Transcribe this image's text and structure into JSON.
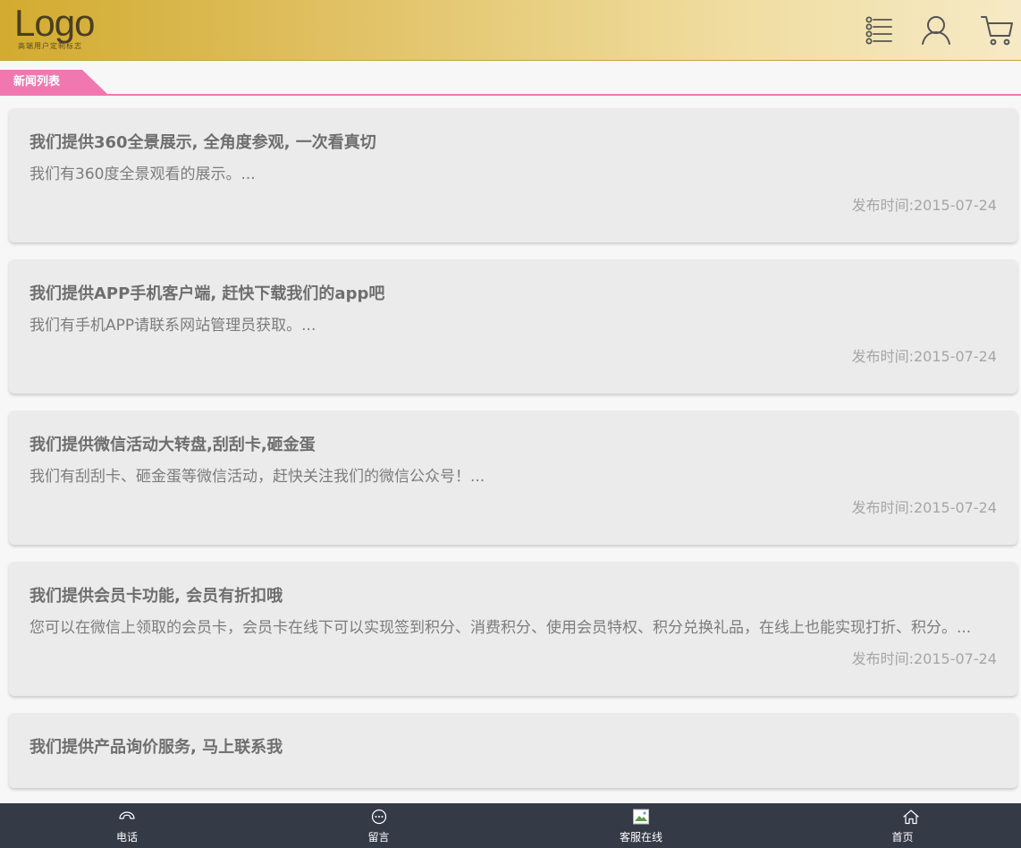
{
  "header": {
    "logo_text": "Logo",
    "logo_subtitle": "高端用户定制标志",
    "icons": [
      "menu-list-icon",
      "user-icon",
      "cart-icon"
    ],
    "gradient_colors": [
      "#d2ab2f",
      "#f6eac6"
    ]
  },
  "category": {
    "label": "新闻列表",
    "accent_color": "#f177b0"
  },
  "news": [
    {
      "title": "我们提供360全景展示, 全角度参观, 一次看真切",
      "summary": "我们有360度全景观看的展示。...",
      "date": "发布时间:2015-07-24"
    },
    {
      "title": "我们提供APP手机客户端, 赶快下载我们的app吧",
      "summary": "我们有手机APP请联系网站管理员获取。...",
      "date": "发布时间:2015-07-24"
    },
    {
      "title": "我们提供微信活动大转盘,刮刮卡,砸金蛋",
      "summary": "我们有刮刮卡、砸金蛋等微信活动，赶快关注我们的微信公众号！...",
      "date": "发布时间:2015-07-24"
    },
    {
      "title": "我们提供会员卡功能, 会员有折扣哦",
      "summary": "您可以在微信上领取的会员卡，会员卡在线下可以实现签到积分、消费积分、使用会员特权、积分兑换礼品，在线上也能实现打折、积分。...",
      "date": "发布时间:2015-07-24"
    },
    {
      "title": "我们提供产品询价服务, 马上联系我",
      "summary": "",
      "date": ""
    }
  ],
  "footer_nav": [
    {
      "label": "电话",
      "icon": "phone-icon"
    },
    {
      "label": "留言",
      "icon": "message-icon"
    },
    {
      "label": "客服在线",
      "icon": "broken-image-icon"
    },
    {
      "label": "首页",
      "icon": "home-icon"
    }
  ],
  "colors": {
    "footer_bg": "#343a46",
    "card_bg": "#ebebeb"
  }
}
